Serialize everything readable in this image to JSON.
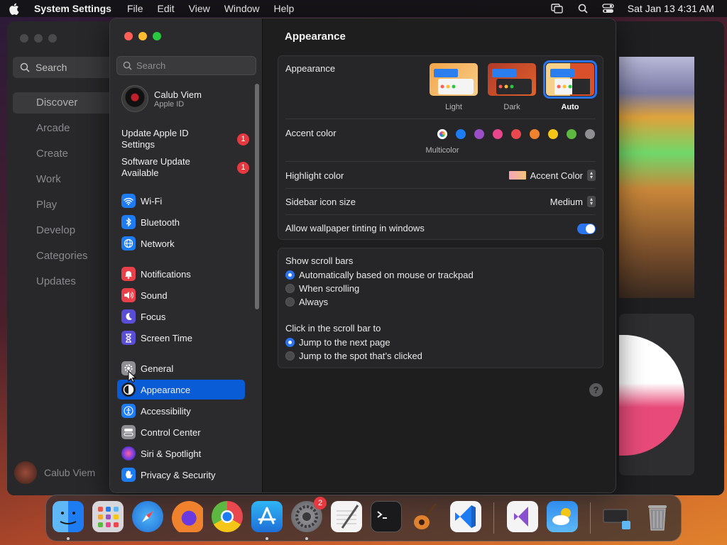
{
  "menubar": {
    "app_name": "System Settings",
    "menus": [
      "File",
      "Edit",
      "View",
      "Window",
      "Help"
    ],
    "clock": "Sat Jan 13  4:31 AM"
  },
  "background_app": {
    "search_label": "Search",
    "nav": [
      "Discover",
      "Arcade",
      "Create",
      "Work",
      "Play",
      "Develop",
      "Categories",
      "Updates"
    ],
    "active_nav": "Discover",
    "user_name": "Calub Viem"
  },
  "sidebar": {
    "search_placeholder": "Search",
    "profile": {
      "name": "Calub Viem",
      "subtitle": "Apple ID"
    },
    "notices": [
      {
        "label": "Update Apple ID Settings",
        "badge": "1"
      },
      {
        "label": "Software Update Available",
        "badge": "1"
      }
    ],
    "items": [
      {
        "label": "Wi-Fi",
        "icon": "wifi-icon",
        "color": "#1e7cf2"
      },
      {
        "label": "Bluetooth",
        "icon": "bluetooth-icon",
        "color": "#1e7cf2"
      },
      {
        "label": "Network",
        "icon": "globe-icon",
        "color": "#1e7cf2"
      },
      {
        "label": "Notifications",
        "icon": "bell-icon",
        "color": "#e9404a"
      },
      {
        "label": "Sound",
        "icon": "speaker-icon",
        "color": "#e9404a"
      },
      {
        "label": "Focus",
        "icon": "moon-icon",
        "color": "#5b4ed6"
      },
      {
        "label": "Screen Time",
        "icon": "hourglass-icon",
        "color": "#5b4ed6"
      },
      {
        "label": "General",
        "icon": "gear-icon",
        "color": "#8e8e93"
      },
      {
        "label": "Appearance",
        "icon": "appearance-icon",
        "color": "#1c1c1e"
      },
      {
        "label": "Accessibility",
        "icon": "accessibility-icon",
        "color": "#1e7cf2"
      },
      {
        "label": "Control Center",
        "icon": "control-center-icon",
        "color": "#8e8e93"
      },
      {
        "label": "Siri & Spotlight",
        "icon": "siri-icon",
        "color": "#b544c6"
      },
      {
        "label": "Privacy & Security",
        "icon": "hand-icon",
        "color": "#1e7cf2"
      }
    ],
    "active_item": "Appearance"
  },
  "content": {
    "title": "Appearance",
    "appearance": {
      "label": "Appearance",
      "options": [
        "Light",
        "Dark",
        "Auto"
      ],
      "selected": "Auto"
    },
    "accent": {
      "label": "Accent color",
      "caption": "Multicolor",
      "colors": [
        "#ff7ad6",
        "#1e7cf2",
        "#9b4fc6",
        "#e8458c",
        "#e8484e",
        "#f0822d",
        "#f5c518",
        "#5cb840",
        "#8e8e93"
      ]
    },
    "highlight": {
      "label": "Highlight color",
      "value": "Accent Color"
    },
    "sidebar_icon_size": {
      "label": "Sidebar icon size",
      "value": "Medium"
    },
    "wallpaper_tinting": {
      "label": "Allow wallpaper tinting in windows",
      "enabled": true
    },
    "scroll_bars": {
      "label": "Show scroll bars",
      "options": [
        "Automatically based on mouse or trackpad",
        "When scrolling",
        "Always"
      ],
      "selected": "Automatically based on mouse or trackpad"
    },
    "click_scroll": {
      "label": "Click in the scroll bar to",
      "options": [
        "Jump to the next page",
        "Jump to the spot that’s clicked"
      ],
      "selected": "Jump to the next page"
    },
    "help": "?"
  },
  "dock": {
    "apps": [
      "Finder",
      "Launchpad",
      "Safari",
      "Firefox",
      "Chrome",
      "App Store",
      "System Settings",
      "TextEdit",
      "Terminal",
      "GarageBand",
      "Visual Studio Code",
      "Visual Studio",
      "Weather",
      "Downloads",
      "Trash"
    ],
    "system_settings_badge": "2"
  }
}
